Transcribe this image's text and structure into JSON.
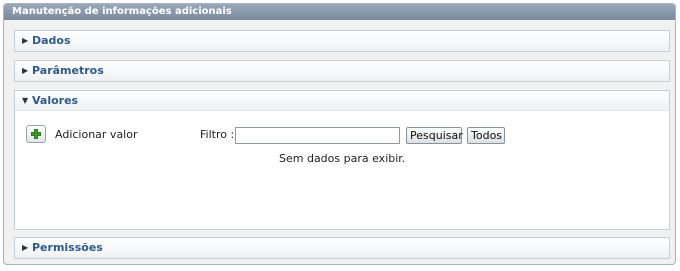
{
  "panel": {
    "title": "Manutenção de informações adicionais"
  },
  "sections": {
    "dados": {
      "label": "Dados",
      "expanded": false
    },
    "parametros": {
      "label": "Parâmetros",
      "expanded": false
    },
    "valores": {
      "label": "Valores",
      "expanded": true,
      "add_label": "Adicionar valor",
      "filter_label": "Filtro :",
      "filter_value": "",
      "search_button": "Pesquisar",
      "all_button": "Todos",
      "empty_message": "Sem dados para exibir."
    },
    "permissoes": {
      "label": "Permissões",
      "expanded": false
    }
  },
  "icons": {
    "collapsed": "triangle-right-icon",
    "expanded": "triangle-down-icon",
    "add": "plus-icon"
  },
  "colors": {
    "header_bg": "#8a98aa",
    "section_title": "#2f5a8a",
    "plus_green": "#3f9d2a"
  }
}
